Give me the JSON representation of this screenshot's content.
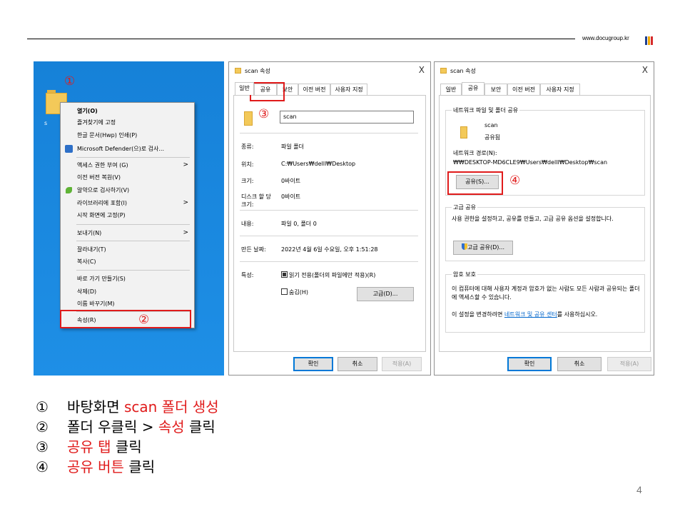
{
  "header": {
    "site": "www.docugroup.kr",
    "logo_colors": [
      "#1f3f8f",
      "#f2a900",
      "#d62b2b"
    ]
  },
  "markers": {
    "m1": "①",
    "m2": "②",
    "m3": "③",
    "m4": "④"
  },
  "desktop": {
    "folder_caption": "s"
  },
  "context_menu": {
    "items": [
      {
        "label": "열기(O)"
      },
      {
        "label": "즐겨찾기에 고정"
      },
      {
        "label": "한글 문서(Hwp) 인쇄(P)"
      },
      {
        "label": "Microsoft Defender(으)로 검사..."
      },
      {
        "label": "액세스 권한 부여 (G)"
      },
      {
        "label": "이전 버전 복원(V)"
      },
      {
        "label": "알약으로 검사하기(V)"
      },
      {
        "label": "라이브러리에 포함(I)"
      },
      {
        "label": "시작 화면에 고정(P)"
      },
      {
        "label": "보내기(N)"
      },
      {
        "label": "잘라내기(T)"
      },
      {
        "label": "복사(C)"
      },
      {
        "label": "바로 가기 만들기(S)"
      },
      {
        "label": "삭제(D)"
      },
      {
        "label": "이름 바꾸기(M)"
      },
      {
        "label": "속성(R)"
      }
    ],
    "submenu_arrow": ">"
  },
  "dialog1": {
    "title": "scan 속성",
    "close": "X",
    "tabs": [
      "일반",
      "공유",
      "보안",
      "이전 버전",
      "사용자 지정"
    ],
    "name_value": "scan",
    "fields": [
      {
        "label": "종류:",
        "value": "파일 폴더"
      },
      {
        "label": "위치:",
        "value": "C:₩Users₩delll₩Desktop"
      },
      {
        "label": "크기:",
        "value": "0바이트"
      },
      {
        "label": "디스크 할 당 크기:",
        "value": "0바이트"
      },
      {
        "label": "내용:",
        "value": "파일 0, 폴더 0"
      },
      {
        "label": "만든 날짜:",
        "value": "2022년 4월 6일 수요일, 오후 1:51:28"
      },
      {
        "label": "특성:",
        "value": ""
      }
    ],
    "readonly_label": "읽기 전용(폴더의 파일에만 적용)(R)",
    "hidden_label": "숨김(H)",
    "advanced_button": "고급(D)...",
    "ok": "확인",
    "cancel": "취소",
    "apply": "적용(A)"
  },
  "dialog2": {
    "title": "scan 속성",
    "close": "X",
    "tabs": [
      "일반",
      "공유",
      "보안",
      "이전 버전",
      "사용자 지정"
    ],
    "network_group_title": "네트워크 파일 및 폴더 공유",
    "folder_name": "scan",
    "folder_state": "공유됨",
    "network_path_label": "네트워크 경로(N):",
    "network_path": "₩₩DESKTOP-MD6CLE9₩Users₩delll₩Desktop₩scan",
    "share_button": "공유(S)...",
    "adv_group_title": "고급 공유",
    "adv_desc": "사용 권한을 설정하고, 공유를 만들고, 고급 공유 옵션을 설정합니다.",
    "adv_button": "고급 공유(D)...",
    "pw_group_title": "암호 보호",
    "pw_desc": "이 컴퓨터에 대해 사용자 계정과 암호가 없는 사람도 모든 사람과 공유되는 폴더에 액세스할 수 있습니다.",
    "pw_change_prefix": "이 설정을 변경하려면 ",
    "pw_link": "네트워크 및 공유 센터",
    "pw_change_suffix": "를 사용하십시오.",
    "ok": "확인",
    "cancel": "취소",
    "apply": "적용(A)"
  },
  "steps": [
    {
      "num": "①",
      "parts": [
        {
          "text": "바탕화면 ",
          "red": false
        },
        {
          "text": "scan 폴더 생성",
          "red": true
        }
      ]
    },
    {
      "num": "②",
      "parts": [
        {
          "text": "폴더 우클릭 > ",
          "red": false
        },
        {
          "text": "속성",
          "red": true
        },
        {
          "text": " 클릭",
          "red": false
        }
      ]
    },
    {
      "num": "③",
      "parts": [
        {
          "text": "공유 탭",
          "red": true
        },
        {
          "text": " 클릭",
          "red": false
        }
      ]
    },
    {
      "num": "④",
      "parts": [
        {
          "text": "공유 버튼",
          "red": true
        },
        {
          "text": " 클릭",
          "red": false
        }
      ]
    }
  ],
  "page_number": "4"
}
